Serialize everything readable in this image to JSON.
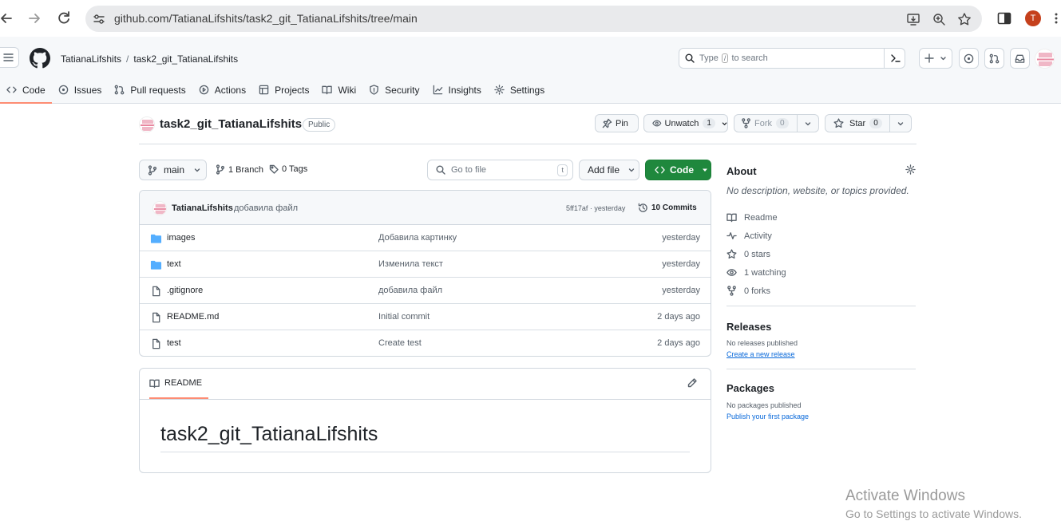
{
  "browser": {
    "url": "github.com/TatianaLifshits/task2_git_TatianaLifshits/tree/main",
    "profile_initial": "T"
  },
  "header": {
    "owner": "TatianaLifshits",
    "separator": "/",
    "repo": "task2_git_TatianaLifshits",
    "search_prefix": "Type",
    "search_key": "/",
    "search_suffix": "to search"
  },
  "tabs": [
    {
      "label": "Code",
      "icon": "code-icon",
      "active": true
    },
    {
      "label": "Issues",
      "icon": "issue-icon"
    },
    {
      "label": "Pull requests",
      "icon": "pull-request-icon"
    },
    {
      "label": "Actions",
      "icon": "play-icon"
    },
    {
      "label": "Projects",
      "icon": "table-icon"
    },
    {
      "label": "Wiki",
      "icon": "book-icon"
    },
    {
      "label": "Security",
      "icon": "shield-icon"
    },
    {
      "label": "Insights",
      "icon": "graph-icon"
    },
    {
      "label": "Settings",
      "icon": "gear-icon"
    }
  ],
  "repo": {
    "name": "task2_git_TatianaLifshits",
    "visibility": "Public",
    "pin_label": "Pin",
    "watch_label": "Unwatch",
    "watch_count": "1",
    "fork_label": "Fork",
    "fork_count": "0",
    "star_label": "Star",
    "star_count": "0"
  },
  "toolbar": {
    "branch": "main",
    "branches": "1 Branch",
    "tags": "0 Tags",
    "goto_placeholder": "Go to file",
    "goto_key": "t",
    "add_file": "Add file",
    "code": "Code"
  },
  "commit": {
    "author": "TatianaLifshits",
    "message": "добавила файл",
    "hash_time": "5ff17af · yesterday",
    "count": "10 Commits"
  },
  "files": [
    {
      "name": "images",
      "type": "folder",
      "message": "Добавила картинку",
      "date": "yesterday"
    },
    {
      "name": "text",
      "type": "folder",
      "message": "Изменила текст",
      "date": "yesterday"
    },
    {
      "name": ".gitignore",
      "type": "file",
      "message": "добавила файл",
      "date": "yesterday"
    },
    {
      "name": "README.md",
      "type": "file",
      "message": "Initial commit",
      "date": "2 days ago"
    },
    {
      "name": "test",
      "type": "file",
      "message": "Create test",
      "date": "2 days ago"
    }
  ],
  "readme": {
    "tab": "README",
    "heading": "task2_git_TatianaLifshits"
  },
  "about": {
    "title": "About",
    "description": "No description, website, or topics provided.",
    "items": [
      {
        "label": "Readme",
        "icon": "book-icon"
      },
      {
        "label": "Activity",
        "icon": "pulse-icon"
      },
      {
        "label": "0 stars",
        "icon": "star-icon"
      },
      {
        "label": "1 watching",
        "icon": "eye-icon"
      },
      {
        "label": "0 forks",
        "icon": "fork-icon"
      }
    ]
  },
  "releases": {
    "title": "Releases",
    "empty": "No releases published",
    "link": "Create a new release"
  },
  "packages": {
    "title": "Packages",
    "empty": "No packages published",
    "link": "Publish your first package"
  },
  "watermark": {
    "line1": "Activate Windows",
    "line2": "Go to Settings to activate Windows."
  },
  "colors": {
    "accent_tab": "#fd8c73",
    "code_button": "#1f883d",
    "link": "#0969da",
    "folder": "#54aeff"
  }
}
